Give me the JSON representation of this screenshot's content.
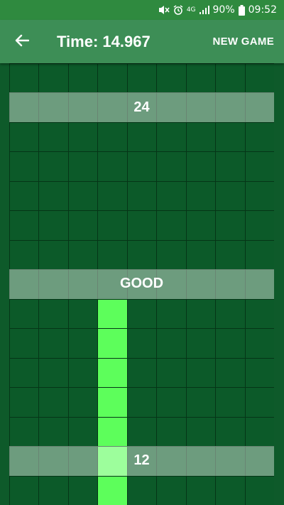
{
  "status_bar": {
    "network": "4G",
    "battery": "90%",
    "time": "09:52"
  },
  "header": {
    "back_icon": "arrow-left-icon",
    "timer_text": "Time: 14.967",
    "new_game_label": "NEW GAME"
  },
  "board": {
    "columns": 9,
    "rows": 15,
    "first_row_offset": 0,
    "lit_cells": [
      [
        8,
        3
      ],
      [
        9,
        3
      ],
      [
        10,
        3
      ],
      [
        11,
        3
      ],
      [
        12,
        3
      ],
      [
        13,
        3
      ],
      [
        14,
        3
      ]
    ],
    "bands": [
      {
        "row": 1,
        "text": "24"
      },
      {
        "row": 7,
        "text": "GOOD"
      },
      {
        "row": 13,
        "text": "12"
      }
    ]
  },
  "colors": {
    "status_bar": "#2f8a3f",
    "app_bar": "#3d8e56",
    "board_cell": "#0c5a29",
    "cell_border": "#053517",
    "lit_cell": "#5dfe5b",
    "page_background": "#0e5a2a"
  }
}
